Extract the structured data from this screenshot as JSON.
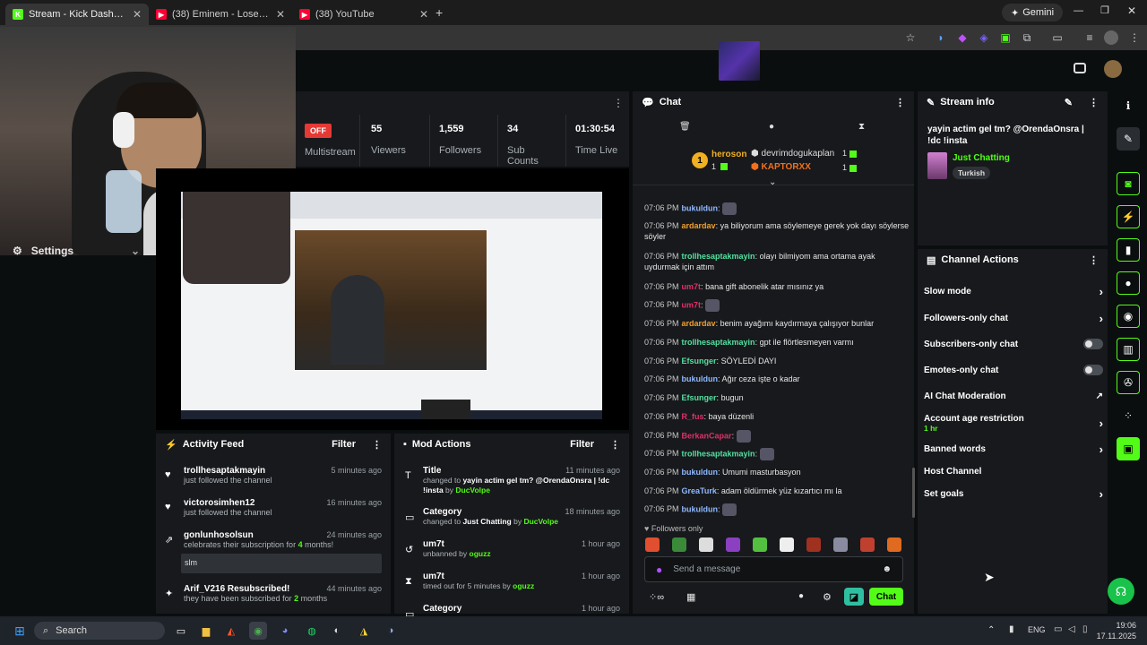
{
  "tabs": [
    {
      "title": "Stream - Kick Dashboard",
      "fav": "K",
      "color": "#53fc18"
    },
    {
      "title": "(38) Eminem - Lose Yourself - Y",
      "fav": "▶",
      "color": "#ff0033"
    },
    {
      "title": "(38) YouTube",
      "fav": "▶",
      "color": "#ff0033"
    }
  ],
  "gemini_label": "Gemini",
  "colors": {
    "accent": "#53fc18",
    "panel": "#17191c",
    "bg": "#0b0e0f"
  },
  "stream": {
    "status": "OFF",
    "status_label": "Multistream"
  },
  "stats": [
    {
      "value": "55",
      "label": "Viewers"
    },
    {
      "value": "1,559",
      "label": "Followers"
    },
    {
      "value": "34",
      "label": "Sub Counts"
    },
    {
      "value": "01:30:54",
      "label": "Time Live"
    }
  ],
  "nav": {
    "settings": "Settings"
  },
  "chat": {
    "title": "Chat",
    "leaders": [
      {
        "rank": "1",
        "name": "heroson",
        "count": "1"
      },
      {
        "name": "devrimdogukaplan",
        "count": "1"
      },
      {
        "name": "KAPTORXX",
        "count": "1"
      }
    ],
    "messages": [
      {
        "time": "07:06 PM",
        "user": "bukuldun",
        "color": "#8fb8ff",
        "text": ""
      },
      {
        "time": "07:06 PM",
        "user": "ardardav",
        "color": "#f0a030",
        "text": "ya biliyorum ama söylemeye gerek yok dayı söylerse söyler"
      },
      {
        "time": "07:06 PM",
        "user": "trollhesaptakmayin",
        "color": "#53e0a0",
        "text": "olayı bilmiyom ama ortama ayak uydurmak için attım"
      },
      {
        "time": "07:06 PM",
        "user": "um7t",
        "color": "#e0306a",
        "text": "bana gift abonelik atar mısınız ya"
      },
      {
        "time": "07:06 PM",
        "user": "um7t",
        "color": "#e0306a",
        "text": ""
      },
      {
        "time": "07:06 PM",
        "user": "ardardav",
        "color": "#f0a030",
        "text": "benim ayağımı kaydırmaya çalışıyor bunlar"
      },
      {
        "time": "07:06 PM",
        "user": "trollhesaptakmayin",
        "color": "#53e0a0",
        "text": "gpt ile flörtlesmeyen varmı"
      },
      {
        "time": "07:06 PM",
        "user": "Efsunger",
        "color": "#53e0a0",
        "text": "SÖYLEDİ DAYI"
      },
      {
        "time": "07:06 PM",
        "user": "bukuldun",
        "color": "#8fb8ff",
        "text": "Ağır ceza işte o kadar"
      },
      {
        "time": "07:06 PM",
        "user": "Efsunger",
        "color": "#53e0a0",
        "text": "bugun"
      },
      {
        "time": "07:06 PM",
        "user": "R_fus",
        "color": "#e0306a",
        "text": "baya düzenli"
      },
      {
        "time": "07:06 PM",
        "user": "BerkanCapar",
        "color": "#e0306a",
        "text": ""
      },
      {
        "time": "07:06 PM",
        "user": "trollhesaptakmayin",
        "color": "#53e0a0",
        "text": ""
      },
      {
        "time": "07:06 PM",
        "user": "bukuldun",
        "color": "#8fb8ff",
        "text": "Umumi masturbasyon"
      },
      {
        "time": "07:06 PM",
        "user": "GreaTurk",
        "color": "#8fb8ff",
        "text": "adam öldürmek yüz kızartıcı mı la"
      },
      {
        "time": "07:06 PM",
        "user": "bukuldun",
        "color": "#8fb8ff",
        "text": ""
      }
    ],
    "followers_only": "Followers only",
    "placeholder": "Send a message",
    "send_label": "Chat"
  },
  "stream_info": {
    "title": "Stream info",
    "stream_title": "yayin actim gel tm? @OrendaOnsra | !dc !insta",
    "category": "Just Chatting",
    "language": "Turkish"
  },
  "channel_actions": {
    "title": "Channel Actions",
    "items": [
      {
        "label": "Slow mode",
        "kind": "arrow"
      },
      {
        "label": "Followers-only chat",
        "kind": "arrow"
      },
      {
        "label": "Subscribers-only chat",
        "kind": "toggle"
      },
      {
        "label": "Emotes-only chat",
        "kind": "toggle"
      },
      {
        "label": "AI Chat Moderation",
        "kind": "ext"
      },
      {
        "label": "Account age restriction",
        "kind": "arrow",
        "sub": "1 hr"
      },
      {
        "label": "Banned words",
        "kind": "arrow"
      },
      {
        "label": "Host Channel",
        "kind": "none"
      },
      {
        "label": "Set goals",
        "kind": "arrow"
      }
    ]
  },
  "activity": {
    "title": "Activity Feed",
    "filter": "Filter",
    "items": [
      {
        "name": "trollhesaptakmayin",
        "sub": "just followed the channel",
        "time": "5 minutes ago"
      },
      {
        "name": "victorosimhen12",
        "sub": "just followed the channel",
        "time": "16 minutes ago"
      },
      {
        "name": "gonlunhosolsun",
        "sub_pre": "celebrates their subscription for ",
        "sub_num": "4",
        "sub_post": " months!",
        "time": "24 minutes ago",
        "note": "slm"
      },
      {
        "name": "Arif_V216 Resubscribed!",
        "sub_pre": "they have been subscribed for ",
        "sub_num": "2",
        "sub_post": " months",
        "time": "44 minutes ago"
      }
    ]
  },
  "mod": {
    "title": "Mod Actions",
    "filter": "Filter",
    "items": [
      {
        "name": "Title",
        "pre": "changed to ",
        "val": "yayin actim gel tm? @OrendaOnsra | !dc !insta",
        "by": " by ",
        "who": "DucVolpe",
        "time": "11 minutes ago"
      },
      {
        "name": "Category",
        "pre": "changed to ",
        "val": "Just Chatting",
        "by": " by ",
        "who": "DucVolpe",
        "time": "18 minutes ago"
      },
      {
        "name": "um7t",
        "pre": "unbanned by ",
        "who": "oguzz",
        "time": "1 hour ago"
      },
      {
        "name": "um7t",
        "pre": "timed out for 5 minutes by ",
        "who": "oguzz",
        "time": "1 hour ago"
      },
      {
        "name": "Category",
        "time": "1 hour ago"
      }
    ]
  },
  "taskbar": {
    "search": "Search",
    "lang": "ENG",
    "time": "19:06",
    "date": "17.11.2025"
  }
}
